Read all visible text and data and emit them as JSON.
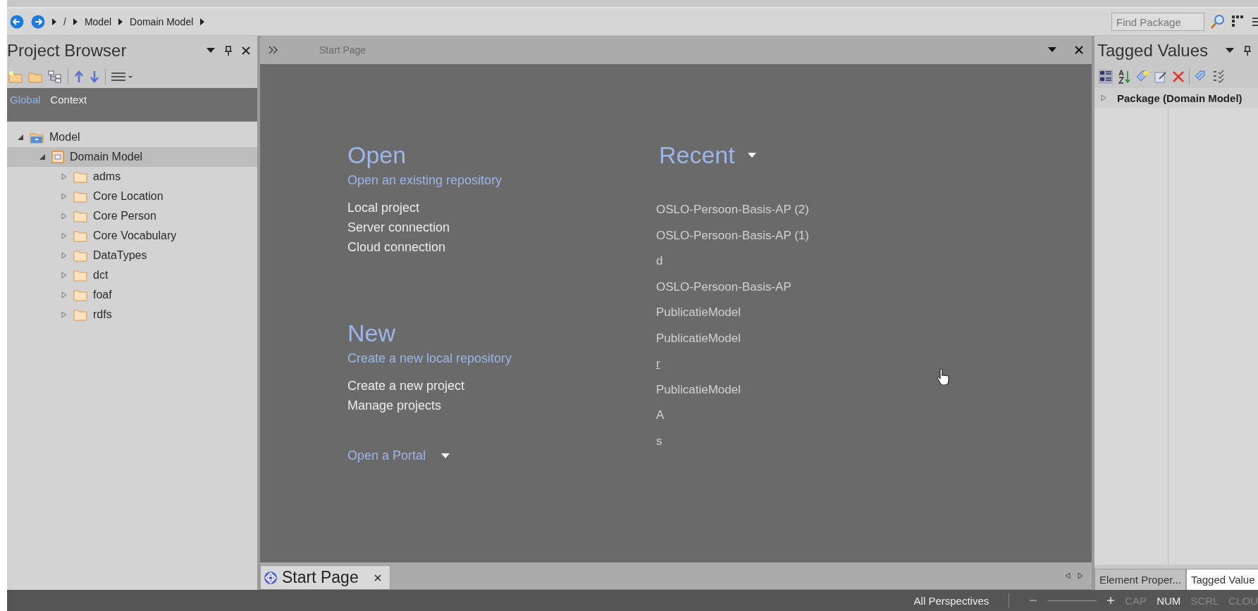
{
  "breadcrumb": {
    "items": [
      "/",
      "Model",
      "Domain Model"
    ]
  },
  "search": {
    "placeholder": "Find Package"
  },
  "project_browser": {
    "title": "Project Browser",
    "tabs": [
      {
        "label": "Global",
        "selected": true
      },
      {
        "label": "Context",
        "selected": false
      }
    ],
    "tree": [
      {
        "label": "Model",
        "kind": "root",
        "expanded": true,
        "selected": false,
        "children": [
          {
            "label": "Domain Model",
            "kind": "package",
            "expanded": true,
            "selected": true,
            "children": [
              {
                "label": "adms",
                "kind": "folder",
                "expanded": false,
                "selected": false
              },
              {
                "label": "Core Location",
                "kind": "folder",
                "expanded": false,
                "selected": false
              },
              {
                "label": "Core Person",
                "kind": "folder",
                "expanded": false,
                "selected": false
              },
              {
                "label": "Core Vocabulary",
                "kind": "folder",
                "expanded": false,
                "selected": false
              },
              {
                "label": "DataTypes",
                "kind": "folder",
                "expanded": false,
                "selected": false
              },
              {
                "label": "dct",
                "kind": "folder",
                "expanded": false,
                "selected": false
              },
              {
                "label": "foaf",
                "kind": "folder",
                "expanded": false,
                "selected": false
              },
              {
                "label": "rdfs",
                "kind": "folder",
                "expanded": false,
                "selected": false
              }
            ]
          }
        ]
      }
    ]
  },
  "start_page": {
    "header_title": "Start Page",
    "open": {
      "title": "Open",
      "subtitle": "Open an existing repository",
      "links": [
        "Local project",
        "Server connection",
        "Cloud connection"
      ]
    },
    "new": {
      "title": "New",
      "subtitle": "Create a new local repository",
      "links": [
        "Create a new project",
        "Manage projects"
      ]
    },
    "portal": "Open a Portal",
    "recent": {
      "title": "Recent",
      "items": [
        {
          "label": "OSLO-Persoon-Basis-AP (2)",
          "hovered": false
        },
        {
          "label": "OSLO-Persoon-Basis-AP (1)",
          "hovered": false
        },
        {
          "label": "d",
          "hovered": false
        },
        {
          "label": "OSLO-Persoon-Basis-AP",
          "hovered": false
        },
        {
          "label": "PublicatieModel",
          "hovered": false
        },
        {
          "label": "PublicatieModel",
          "hovered": false
        },
        {
          "label": "r",
          "hovered": true
        },
        {
          "label": "PublicatieModel",
          "hovered": false
        },
        {
          "label": "A",
          "hovered": false
        },
        {
          "label": "s",
          "hovered": false
        }
      ]
    }
  },
  "document_tabs": [
    {
      "label": "Start Page",
      "selected": true
    }
  ],
  "tagged_values": {
    "title": "Tagged Values",
    "rows": [
      {
        "label": "Package (Domain Model)",
        "expanded": false
      }
    ],
    "tabs": [
      {
        "label": "Element Proper...",
        "selected": false
      },
      {
        "label": "Tagged Value",
        "selected": true
      }
    ]
  },
  "status_bar": {
    "perspective": "All Perspectives",
    "indicators": [
      {
        "label": "CAP",
        "on": false
      },
      {
        "label": "NUM",
        "on": true
      },
      {
        "label": "SCRL",
        "on": false
      },
      {
        "label": "CLOU",
        "on": false
      }
    ]
  }
}
